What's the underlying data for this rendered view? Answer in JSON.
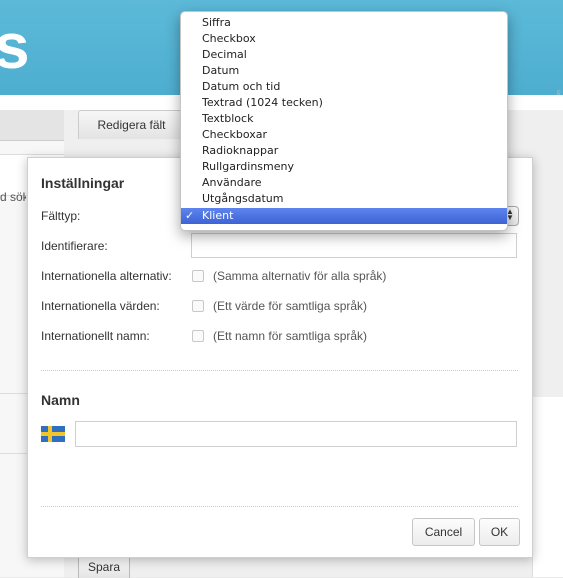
{
  "dialog": {
    "title": "Inställningar",
    "labels": {
      "field_type": "Fälttyp:",
      "identifier": "Identifierare:",
      "intl_options": "Internationella alternativ:",
      "intl_values": "Internationella värden:",
      "intl_name": "Internationellt namn:"
    },
    "checkboxes": {
      "intl_options": "(Samma alternativ för alla språk)",
      "intl_values": "(Ett värde för samtliga språk)",
      "intl_name": "(Ett namn för samtliga språk)"
    },
    "identifier_value": "",
    "name_section_title": "Namn",
    "name_value": "",
    "cancel_label": "Cancel",
    "ok_label": "OK"
  },
  "dropdown": {
    "check_mark": "✓",
    "selected": "Klient",
    "options": [
      "Siffra",
      "Checkbox",
      "Decimal",
      "Datum",
      "Datum och tid",
      "Textrad (1024 tecken)",
      "Textblock",
      "Checkboxar",
      "Radioknappar",
      "Rullgardinsmeny",
      "Användare",
      "Utgångsdatum",
      "Klient"
    ]
  },
  "background": {
    "logo_fragment": "s",
    "tab_label": "Redigera fält",
    "left_search": "d sök",
    "save_label": "Spara"
  },
  "colors": {
    "header": "#4eaed0",
    "selection": "#3e63d6"
  }
}
